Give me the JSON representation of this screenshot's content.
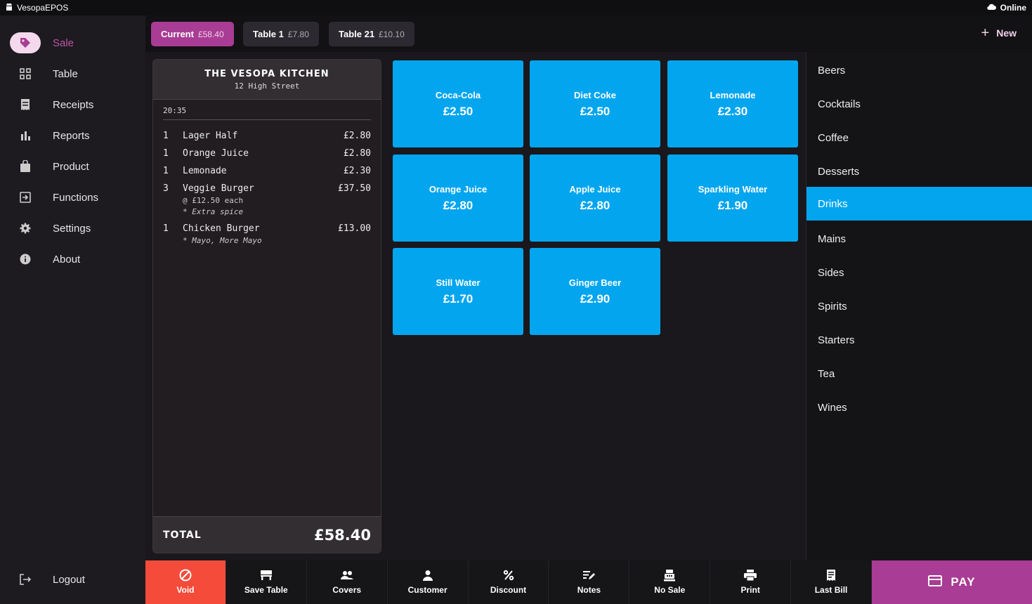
{
  "app": {
    "title": "VesopaEPOS",
    "status": "Online"
  },
  "sidebar": {
    "items": [
      {
        "label": "Sale",
        "icon": "tag-icon",
        "active": true
      },
      {
        "label": "Table",
        "icon": "grid-icon"
      },
      {
        "label": "Receipts",
        "icon": "receipt-icon"
      },
      {
        "label": "Reports",
        "icon": "bar-chart-icon"
      },
      {
        "label": "Product",
        "icon": "bag-icon"
      },
      {
        "label": "Functions",
        "icon": "function-icon"
      },
      {
        "label": "Settings",
        "icon": "gear-icon"
      },
      {
        "label": "About",
        "icon": "info-icon"
      }
    ],
    "logout": "Logout"
  },
  "tabs": [
    {
      "name": "Current",
      "amount": "£58.40",
      "active": true
    },
    {
      "name": "Table 1",
      "amount": "£7.80"
    },
    {
      "name": "Table 21",
      "amount": "£10.10"
    }
  ],
  "new_label": "New",
  "receipt": {
    "name": "THE VESOPA KITCHEN",
    "address": "12 High Street",
    "time": "20:35",
    "lines": [
      {
        "qty": "1",
        "name": "Lager Half",
        "price": "£2.80"
      },
      {
        "qty": "1",
        "name": "Orange Juice",
        "price": "£2.80"
      },
      {
        "qty": "1",
        "name": "Lemonade",
        "price": "£2.30"
      },
      {
        "qty": "3",
        "name": "Veggie Burger",
        "price": "£37.50",
        "each": "@ £12.50 each",
        "note": "* Extra spice"
      },
      {
        "qty": "1",
        "name": "Chicken Burger",
        "price": "£13.00",
        "note": "* Mayo, More Mayo"
      }
    ],
    "total_label": "TOTAL",
    "total": "£58.40"
  },
  "products": [
    {
      "name": "Coca-Cola",
      "price": "£2.50"
    },
    {
      "name": "Diet Coke",
      "price": "£2.50"
    },
    {
      "name": "Lemonade",
      "price": "£2.30"
    },
    {
      "name": "Orange Juice",
      "price": "£2.80"
    },
    {
      "name": "Apple Juice",
      "price": "£2.80"
    },
    {
      "name": "Sparkling Water",
      "price": "£1.90"
    },
    {
      "name": "Still Water",
      "price": "£1.70"
    },
    {
      "name": "Ginger Beer",
      "price": "£2.90"
    }
  ],
  "categories": [
    "Beers",
    "Cocktails",
    "Coffee",
    "Desserts",
    "Drinks",
    "Mains",
    "Sides",
    "Spirits",
    "Starters",
    "Tea",
    "Wines"
  ],
  "active_category": "Drinks",
  "actions": [
    {
      "label": "Void",
      "icon": "void-icon"
    },
    {
      "label": "Save Table",
      "icon": "save-table-icon"
    },
    {
      "label": "Covers",
      "icon": "covers-icon"
    },
    {
      "label": "Customer",
      "icon": "customer-icon"
    },
    {
      "label": "Discount",
      "icon": "percent-icon"
    },
    {
      "label": "Notes",
      "icon": "notes-icon"
    },
    {
      "label": "No Sale",
      "icon": "register-icon"
    },
    {
      "label": "Print",
      "icon": "print-icon"
    },
    {
      "label": "Last Bill",
      "icon": "last-bill-icon"
    }
  ],
  "pay_label": "PAY",
  "colors": {
    "accent": "#a93c94",
    "product": "#03a5ef",
    "void": "#f44b3a"
  }
}
